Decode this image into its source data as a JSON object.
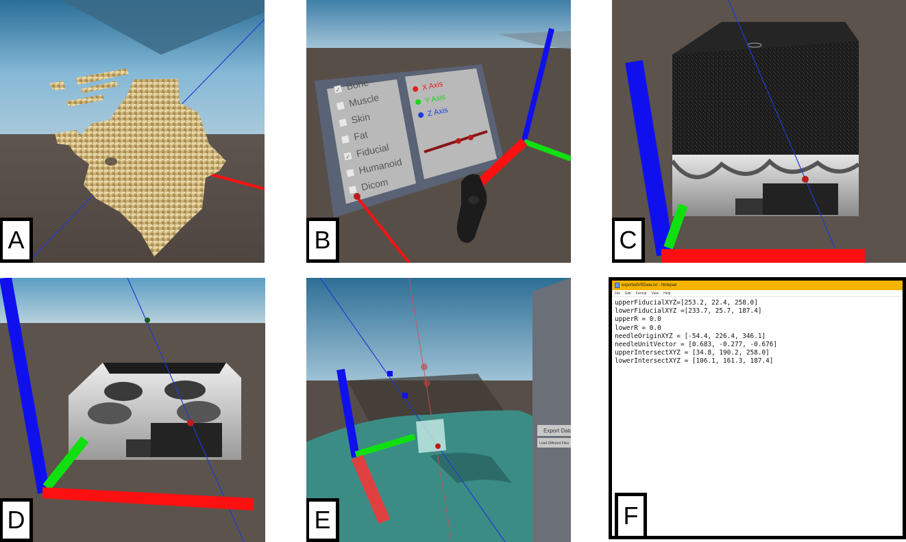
{
  "labels": {
    "a": "A",
    "b": "B",
    "c": "C",
    "d": "D",
    "e": "E",
    "f": "F"
  },
  "panel_b": {
    "layers": [
      "Bone",
      "Muscle",
      "Skin",
      "Fat",
      "Fiducial",
      "Humanoid",
      "Dicom"
    ],
    "checked": [
      true,
      false,
      false,
      false,
      true,
      false,
      false
    ],
    "axes": [
      {
        "label": "X Axis",
        "color": "#e0201e"
      },
      {
        "label": "Y Axis",
        "color": "#1ed21e"
      },
      {
        "label": "Z Axis",
        "color": "#1e3cdc"
      }
    ]
  },
  "panel_e": {
    "export_button": "Export Data",
    "load_button": "Load Different Files"
  },
  "notepad": {
    "title": "exportedVRData.txt - Notepad",
    "menu": [
      "File",
      "Edit",
      "Format",
      "View",
      "Help"
    ],
    "lines": [
      "upperFiducialXYZ=[253.2, 22.4, 258.0]",
      "lowerFiducialXYZ =[233.7, 25.7, 187.4]",
      "upperR = 0.0",
      "lowerR = 0.0",
      "needleOriginXYZ = [-54.4, 226.4, 346.1]",
      "needleUnitVector = [0.683, -0.277, -0.676]",
      "upperIntersectXYZ = [34.8, 190.2, 258.0]",
      "lowerIntersectXYZ = [106.1, 161.3, 187.4]"
    ]
  },
  "colors": {
    "x_axis": "#ff1010",
    "y_axis": "#10e010",
    "z_axis": "#1010ee",
    "title_bar": "#f5b400"
  }
}
